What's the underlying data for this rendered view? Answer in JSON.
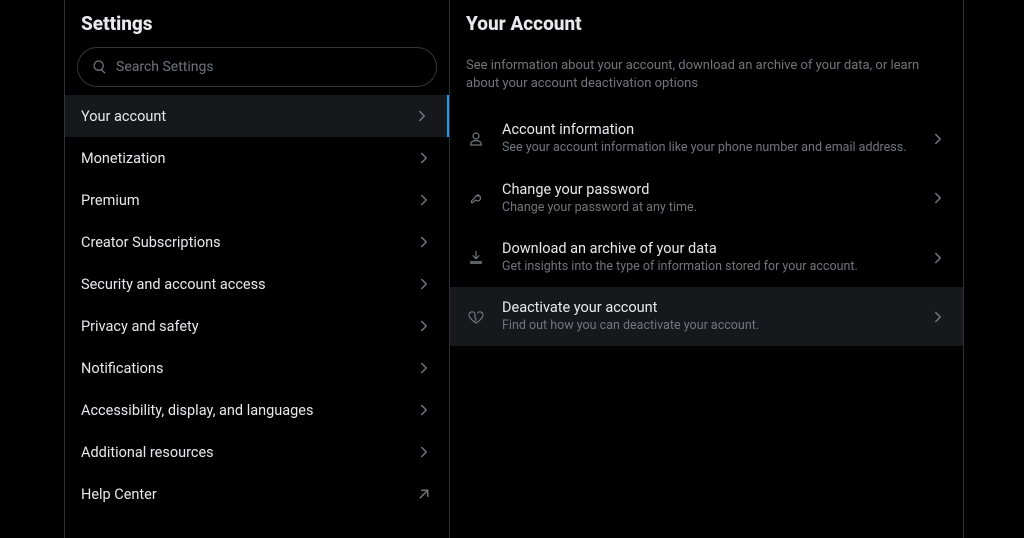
{
  "settings": {
    "title": "Settings",
    "search_placeholder": "Search Settings",
    "nav": [
      {
        "label": "Your account",
        "active": true,
        "external": false
      },
      {
        "label": "Monetization",
        "active": false,
        "external": false
      },
      {
        "label": "Premium",
        "active": false,
        "external": false
      },
      {
        "label": "Creator Subscriptions",
        "active": false,
        "external": false
      },
      {
        "label": "Security and account access",
        "active": false,
        "external": false
      },
      {
        "label": "Privacy and safety",
        "active": false,
        "external": false
      },
      {
        "label": "Notifications",
        "active": false,
        "external": false
      },
      {
        "label": "Accessibility, display, and languages",
        "active": false,
        "external": false
      },
      {
        "label": "Additional resources",
        "active": false,
        "external": false
      },
      {
        "label": "Help Center",
        "active": false,
        "external": true
      }
    ]
  },
  "detail": {
    "title": "Your Account",
    "description": "See information about your account, download an archive of your data, or learn about your account deactivation options",
    "options": [
      {
        "icon": "person-icon",
        "title": "Account information",
        "sub": "See your account information like your phone number and email address.",
        "highlight": false
      },
      {
        "icon": "key-icon",
        "title": "Change your password",
        "sub": "Change your password at any time.",
        "highlight": false
      },
      {
        "icon": "download-icon",
        "title": "Download an archive of your data",
        "sub": "Get insights into the type of information stored for your account.",
        "highlight": false
      },
      {
        "icon": "heart-broken-icon",
        "title": "Deactivate your account",
        "sub": "Find out how you can deactivate your account.",
        "highlight": true
      }
    ]
  }
}
